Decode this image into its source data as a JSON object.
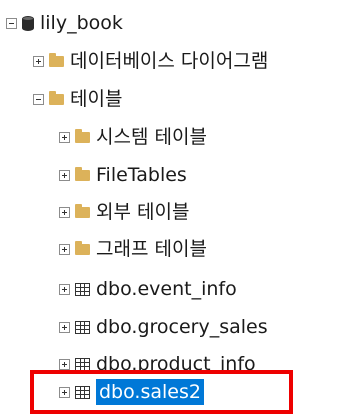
{
  "tree": {
    "root": {
      "label": "lily_book"
    },
    "items": [
      {
        "label": "데이터베이스 다이어그램"
      },
      {
        "label": "테이블"
      },
      {
        "label": "시스템 테이블"
      },
      {
        "label": "FileTables"
      },
      {
        "label": "외부 테이블"
      },
      {
        "label": "그래프 테이블"
      },
      {
        "label": "dbo.event_info"
      },
      {
        "label": "dbo.grocery_sales"
      },
      {
        "label": "dbo.product_info"
      },
      {
        "label": "dbo.sales2"
      }
    ]
  },
  "colors": {
    "selection": "#0078d7",
    "highlight_border": "#ee0000",
    "folder": "#dcb25a"
  },
  "icons": {
    "expanded": "minus-box-icon",
    "collapsed": "plus-box-icon",
    "database": "database-icon",
    "folder": "folder-icon",
    "table": "table-icon"
  }
}
